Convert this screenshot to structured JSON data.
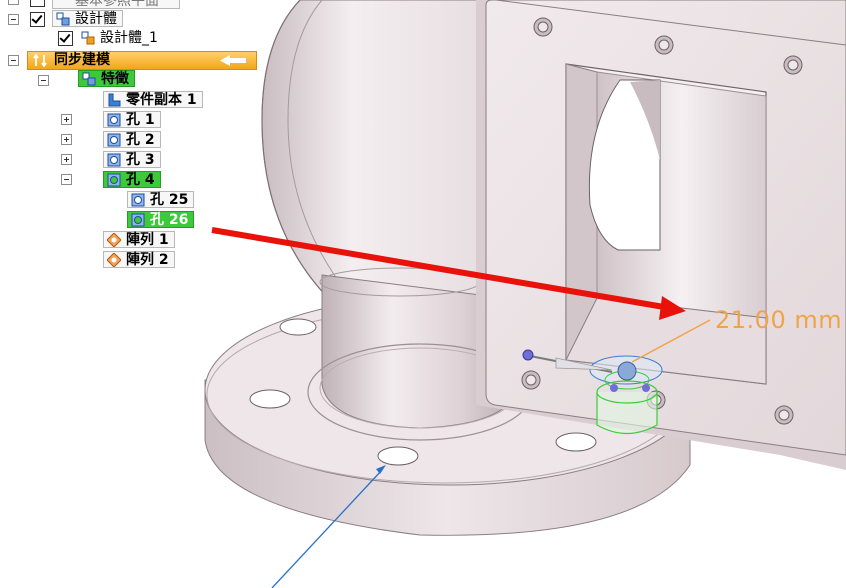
{
  "tree": {
    "row0_label": "基本參照平面",
    "body_label": "設計體",
    "body1_label": "設計體_1",
    "sync_label": "同步建模",
    "features_label": "特徵",
    "copy_label": "零件副本 1",
    "hole1": "孔 1",
    "hole2": "孔 2",
    "hole3": "孔 3",
    "hole4": "孔 4",
    "hole25": "孔 25",
    "hole26": "孔 26",
    "pattern1": "陣列 1",
    "pattern2": "陣列 2"
  },
  "viewport": {
    "dimension_text": "21.00 mm"
  },
  "colors": {
    "selection_green": "#3dc93a",
    "sync_bar": "#f3a51c",
    "annotation_red": "#e8120a",
    "annotation_blue": "#2a6fc9",
    "dimension_orange": "#f0a44a",
    "part_face": "#e9dde1"
  },
  "icons": [
    "collapse-icon",
    "expand-icon",
    "checkbox-icon",
    "design-body-icon",
    "sync-modeling-icon",
    "feature-icon",
    "part-copy-icon",
    "hole-icon",
    "pattern-icon"
  ]
}
